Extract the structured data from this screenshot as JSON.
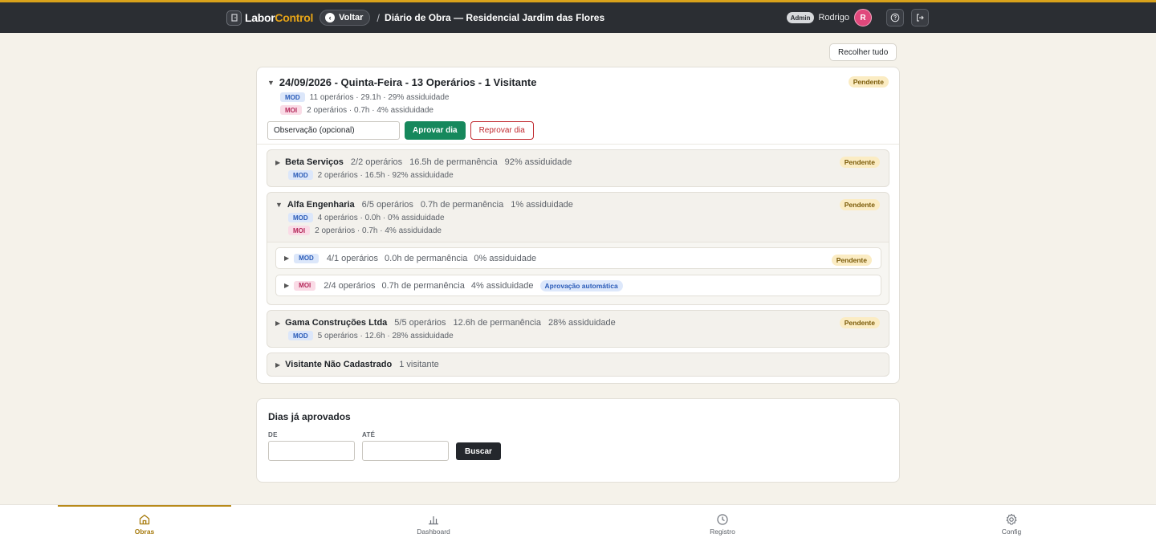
{
  "header": {
    "logo_icon": "door-icon",
    "brand_part1": "Labor",
    "brand_part2": "Control",
    "back_label": "Voltar",
    "separator": "/",
    "page_title": "Diário de Obra — Residencial Jardim das Flores",
    "role": "Admin",
    "user_name": "Rodrigo",
    "avatar_initial": "R",
    "help_icon": "help-circle-icon",
    "logout_icon": "logout-icon"
  },
  "toolbar": {
    "collapse_label": "Recolher tudo"
  },
  "day": {
    "title": "24/09/2026 - Quinta-Feira - 13 Operários - 1 Visitante",
    "status": "Pendente",
    "mod_tag": "MOD",
    "mod_stats": "11 operários · 29.1h · 29% assiduidade",
    "moi_tag": "MOI",
    "moi_stats": "2 operários · 0.7h · 4% assiduidade",
    "obs_placeholder": "Observação (opcional)",
    "approve_label": "Aprovar dia",
    "reject_label": "Reprovar dia"
  },
  "companies": [
    {
      "name": "Beta Serviços",
      "operarios": "2/2 operários",
      "permanencia": "16.5h de permanência",
      "assiduidade": "92% assiduidade",
      "status": "Pendente",
      "mod_tag": "MOD",
      "mod_stats": "2 operários · 16.5h · 92% assiduidade"
    },
    {
      "name": "Alfa Engenharia",
      "operarios": "6/5 operários",
      "permanencia": "0.7h de permanência",
      "assiduidade": "1% assiduidade",
      "status": "Pendente",
      "mod_tag": "MOD",
      "mod_stats": "4 operários · 0.0h · 0% assiduidade",
      "moi_tag": "MOI",
      "moi_stats": "2 operários · 0.7h · 4% assiduidade",
      "groups": [
        {
          "tag": "MOD",
          "operarios": "4/1 operários",
          "permanencia": "0.0h de permanência",
          "assiduidade": "0% assiduidade",
          "status": "Pendente"
        },
        {
          "tag": "MOI",
          "operarios": "2/4 operários",
          "permanencia": "0.7h de permanência",
          "assiduidade": "4% assiduidade",
          "status": "Aprovação automática"
        }
      ]
    },
    {
      "name": "Gama Construções Ltda",
      "operarios": "5/5 operários",
      "permanencia": "12.6h de permanência",
      "assiduidade": "28% assiduidade",
      "status": "Pendente",
      "mod_tag": "MOD",
      "mod_stats": "5 operários · 12.6h · 28% assiduidade"
    },
    {
      "name": "Visitante Não Cadastrado",
      "operarios": "1 visitante"
    }
  ],
  "approved": {
    "title": "Dias já aprovados",
    "from_label": "DE",
    "to_label": "ATÉ",
    "search_label": "Buscar"
  },
  "nav": [
    {
      "label": "Obras",
      "icon": "home-icon",
      "active": true
    },
    {
      "label": "Dashboard",
      "icon": "bar-chart-icon",
      "active": false
    },
    {
      "label": "Registro",
      "icon": "clock-icon",
      "active": false
    },
    {
      "label": "Config",
      "icon": "gear-icon",
      "active": false
    }
  ],
  "colors": {
    "accent": "#d9a21b",
    "approve": "#16885c",
    "reject": "#c0282e",
    "topbar": "#2b2e33"
  }
}
